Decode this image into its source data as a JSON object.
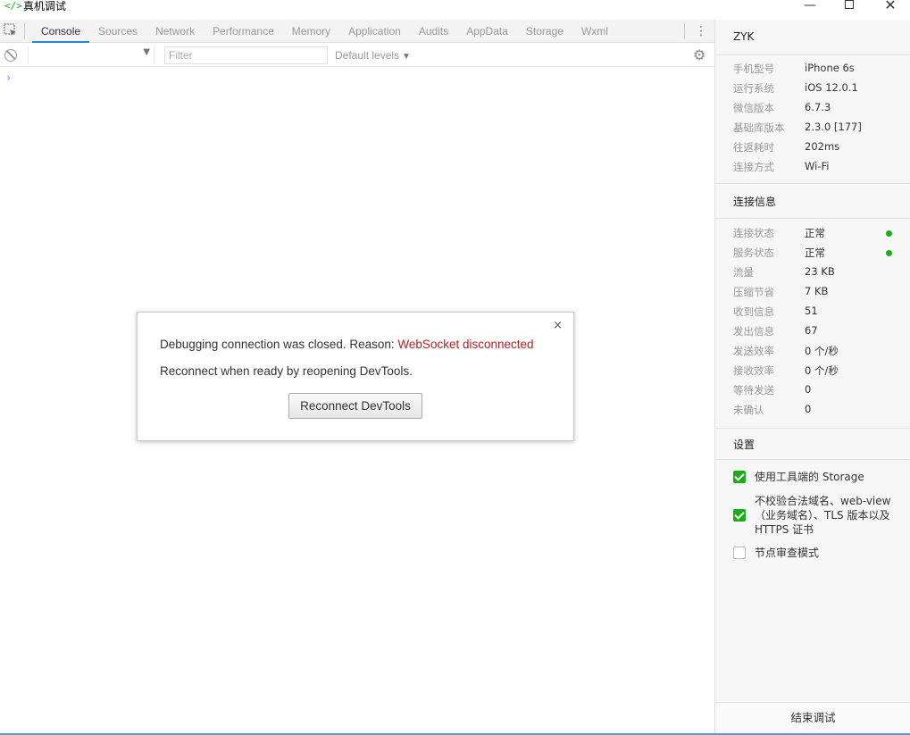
{
  "window": {
    "title": "真机调试",
    "app_icon": "</>",
    "minimize": "—",
    "close": "✕"
  },
  "devtools": {
    "tabs": [
      "Console",
      "Sources",
      "Network",
      "Performance",
      "Memory",
      "Application",
      "Audits",
      "AppData",
      "Storage",
      "Wxml"
    ],
    "active_tab": "Console",
    "filter_placeholder": "Filter",
    "levels_label": "Default levels",
    "prompt": "›"
  },
  "dialog": {
    "message_prefix": "Debugging connection was closed. Reason: ",
    "reason": "WebSocket disconnected",
    "message_2": "Reconnect when ready by reopening DevTools.",
    "button_label": "Reconnect DevTools",
    "close": "×"
  },
  "side": {
    "device": {
      "title": "ZYK",
      "rows": [
        {
          "k": "手机型号",
          "v": "iPhone 6s"
        },
        {
          "k": "运行系统",
          "v": "iOS 12.0.1"
        },
        {
          "k": "微信版本",
          "v": "6.7.3"
        },
        {
          "k": "基础库版本",
          "v": "2.3.0 [177]"
        },
        {
          "k": "往返耗时",
          "v": "202ms"
        },
        {
          "k": "连接方式",
          "v": "Wi-Fi"
        }
      ]
    },
    "connection": {
      "title": "连接信息",
      "rows": [
        {
          "k": "连接状态",
          "v": "正常",
          "status": "ok"
        },
        {
          "k": "服务状态",
          "v": "正常",
          "status": "ok"
        },
        {
          "k": "流量",
          "v": "23 KB"
        },
        {
          "k": "压缩节省",
          "v": "7 KB"
        },
        {
          "k": "收到信息",
          "v": "51"
        },
        {
          "k": "发出信息",
          "v": "67"
        },
        {
          "k": "发送效率",
          "v": "0 个/秒"
        },
        {
          "k": "接收效率",
          "v": "0 个/秒"
        },
        {
          "k": "等待发送",
          "v": "0"
        },
        {
          "k": "未确认",
          "v": "0"
        }
      ]
    },
    "settings": {
      "title": "设置",
      "items": [
        {
          "label": "使用工具端的 Storage",
          "checked": true
        },
        {
          "label": "不校验合法域名、web-view（业务域名）、TLS 版本以及 HTTPS 证书",
          "checked": true
        },
        {
          "label": "节点审查模式",
          "checked": false
        }
      ]
    },
    "end_button": "结束调试"
  },
  "colors": {
    "accent_green": "#1aad19",
    "reason_red": "#b22222",
    "active_tab_underline": "#1e88e5"
  }
}
